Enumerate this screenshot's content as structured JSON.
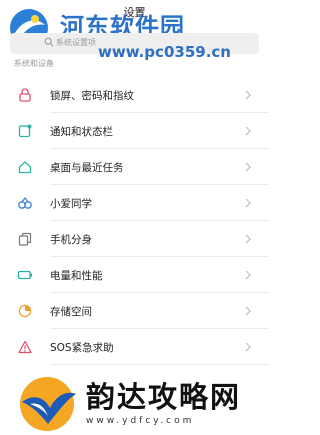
{
  "header": {
    "title": "设置"
  },
  "watermark_top": {
    "title": "河东软件园",
    "url": "www.pc0359.cn"
  },
  "search": {
    "placeholder": "系统设置项"
  },
  "section": {
    "label": "系统和设备"
  },
  "items": [
    {
      "label": "锁屏、密码和指纹",
      "icon": "lock-icon",
      "color": "#e0506e"
    },
    {
      "label": "通知和状态栏",
      "icon": "notification-icon",
      "color": "#2bb3a0"
    },
    {
      "label": "桌面与最近任务",
      "icon": "home-icon",
      "color": "#29b7a3"
    },
    {
      "label": "小爱同学",
      "icon": "assistant-icon",
      "color": "#3a86d8"
    },
    {
      "label": "手机分身",
      "icon": "second-space-icon",
      "color": "#777777"
    },
    {
      "label": "电量和性能",
      "icon": "battery-icon",
      "color": "#25b59e"
    },
    {
      "label": "存储空间",
      "icon": "storage-icon",
      "color": "#f0a030"
    },
    {
      "label": "SOS紧急求助",
      "icon": "sos-icon",
      "color": "#e0506e"
    }
  ],
  "watermark_bottom": {
    "title": "韵达攻略网",
    "url": "www.ydfcy.com"
  },
  "colors": {
    "accent": "#2b73c8",
    "divider": "#ececec",
    "chevron": "#bdbdbd"
  }
}
